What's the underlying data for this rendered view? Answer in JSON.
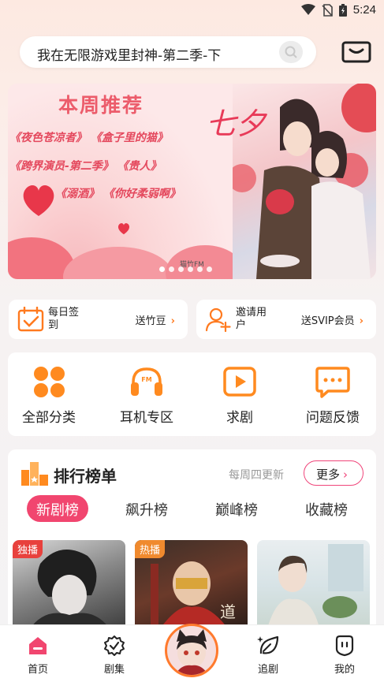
{
  "status_bar": {
    "time": "5:24"
  },
  "search": {
    "query": "我在无限游戏里封神-第二季-下"
  },
  "banner": {
    "title": "本周推荐",
    "lines": [
      "《夜色苍凉者》 《盒子里的猫》",
      "《跨界演员-第二季》 《贵人》",
      "《溺酒》 《你好柔弱啊》"
    ],
    "art_text": "七夕",
    "watermark": "猫竹FM"
  },
  "checkin": {
    "label": "每日签到",
    "action": "送竹豆"
  },
  "invite": {
    "label": "邀请用户",
    "action": "送SVIP会员"
  },
  "categories": [
    {
      "label": "全部分类",
      "icon": "grid-icon"
    },
    {
      "label": "耳机专区",
      "icon": "headphones-icon"
    },
    {
      "label": "求剧",
      "icon": "play-icon"
    },
    {
      "label": "问题反馈",
      "icon": "chat-icon"
    }
  ],
  "ranking": {
    "title": "排行榜单",
    "subtitle": "每周四更新",
    "more": "更多",
    "tabs": [
      "新剧榜",
      "飙升榜",
      "巅峰榜",
      "收藏榜"
    ],
    "covers": [
      {
        "badge": "独播",
        "badge_color": "#e8413d"
      },
      {
        "badge": "热播",
        "badge_color": "#f08a2e"
      },
      {
        "badge": "",
        "badge_color": ""
      }
    ]
  },
  "bottom_nav": [
    {
      "label": "首页",
      "icon": "home-icon"
    },
    {
      "label": "剧集",
      "icon": "badge-icon"
    },
    {
      "label": "",
      "icon": "avatar"
    },
    {
      "label": "追剧",
      "icon": "leaf-icon"
    },
    {
      "label": "我的",
      "icon": "profile-icon"
    }
  ],
  "colors": {
    "accent_orange": "#ff7a1f",
    "accent_pink": "#f1466f"
  }
}
